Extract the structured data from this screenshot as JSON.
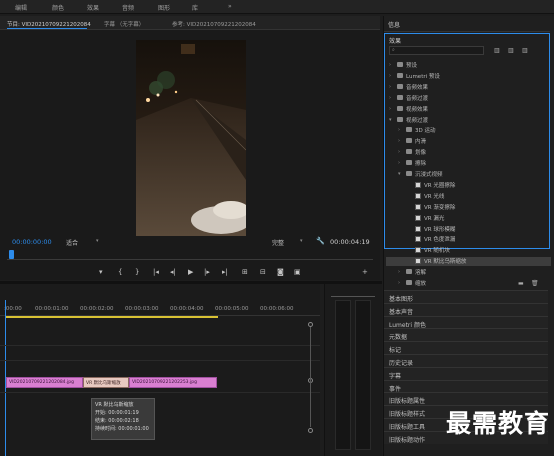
{
  "menu": {
    "items": [
      "编辑",
      "颜色",
      "效果",
      "音频",
      "图形",
      "库",
      "»"
    ]
  },
  "monitor": {
    "tab_source": "节目: VID20210709221202084",
    "tab_captions": "字幕 （无字幕）",
    "tab_reference": "参考: VID20210709221202084",
    "timecode_left": "00:00:00:00",
    "zoom_label": "适合",
    "quality_label": "完整",
    "timecode_right": "00:00:04:19"
  },
  "effects": {
    "panel_title": "信息",
    "tab_effects": "效果",
    "search_placeholder": "",
    "items": [
      {
        "label": "预设",
        "type": "folder",
        "level": 0,
        "expanded": false
      },
      {
        "label": "Lumetri 预设",
        "type": "folder",
        "level": 0,
        "expanded": false
      },
      {
        "label": "音频效果",
        "type": "folder",
        "level": 0,
        "expanded": false
      },
      {
        "label": "音频过渡",
        "type": "folder",
        "level": 0,
        "expanded": false
      },
      {
        "label": "视频效果",
        "type": "folder",
        "level": 0,
        "expanded": false
      },
      {
        "label": "视频过渡",
        "type": "folder",
        "level": 0,
        "expanded": true
      },
      {
        "label": "3D 运动",
        "type": "folder",
        "level": 1,
        "expanded": false
      },
      {
        "label": "内滑",
        "type": "folder",
        "level": 1,
        "expanded": false
      },
      {
        "label": "划像",
        "type": "folder",
        "level": 1,
        "expanded": false
      },
      {
        "label": "擦除",
        "type": "folder",
        "level": 1,
        "expanded": false
      },
      {
        "label": "沉浸式视频",
        "type": "folder",
        "level": 1,
        "expanded": true
      },
      {
        "label": "VR 光圈擦除",
        "type": "effect",
        "level": 2
      },
      {
        "label": "VR 光线",
        "type": "effect",
        "level": 2
      },
      {
        "label": "VR 渐变擦除",
        "type": "effect",
        "level": 2
      },
      {
        "label": "VR 漏光",
        "type": "effect",
        "level": 2
      },
      {
        "label": "VR 球形模糊",
        "type": "effect",
        "level": 2
      },
      {
        "label": "VR 色度泄漏",
        "type": "effect",
        "level": 2
      },
      {
        "label": "VR 随机块",
        "type": "effect",
        "level": 2
      },
      {
        "label": "VR 默比乌斯缩放",
        "type": "effect",
        "level": 2,
        "selected": true
      },
      {
        "label": "溶解",
        "type": "folder",
        "level": 1,
        "expanded": false
      },
      {
        "label": "缩放",
        "type": "folder",
        "level": 1,
        "expanded": false
      },
      {
        "label": "页面剥落",
        "type": "folder",
        "level": 1,
        "expanded": false
      }
    ]
  },
  "panels": [
    "基本图形",
    "基本声音",
    "Lumetri 颜色",
    "元数据",
    "标记",
    "历史记录",
    "字幕",
    "事件",
    "旧版标题属性",
    "旧版标题样式",
    "旧版标题工具",
    "旧版标题动作"
  ],
  "timeline": {
    "ruler": [
      ":00:00",
      "00:00:01:00",
      "00:00:02:00",
      "00:00:03:00",
      "00:00:04:00",
      "00:00:05:00",
      "00:00:06:00"
    ],
    "clip1": "VID20210709221202084.jpg",
    "transition": "VR 默比乌斯缩放",
    "clip2": "VID20210709221202253.jpg",
    "tooltip": {
      "name": "VR 默比乌斯缩放",
      "start": "开始: 00:00:01:19",
      "end": "结束: 00:00:02:18",
      "duration": "持续时间: 00:00:01:00"
    }
  },
  "watermark": "最需教育",
  "colors": {
    "accent": "#2d8ceb",
    "clip": "#d97fd1",
    "selected": "#3d3d3d"
  }
}
